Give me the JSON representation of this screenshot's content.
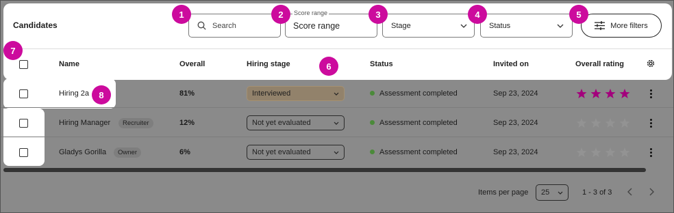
{
  "header": {
    "title": "Candidates"
  },
  "filters": {
    "search_placeholder": "Search",
    "score_range_label": "Score range",
    "score_range_value": "Score range",
    "stage": "Stage",
    "status": "Status",
    "more_filters": "More filters"
  },
  "columns": [
    "Name",
    "Overall",
    "Hiring stage",
    "Status",
    "Invited on",
    "Overall rating"
  ],
  "rows": [
    {
      "name": "Hiring 2a",
      "tag": "",
      "overall": "81%",
      "stage": "Interviewed",
      "status": "Assessment completed",
      "invited": "Sep 23, 2024",
      "rating": 4
    },
    {
      "name": "Hiring Manager",
      "tag": "Recruiter",
      "overall": "12%",
      "stage": "Not yet evaluated",
      "status": "Assessment completed",
      "invited": "Sep 23, 2024",
      "rating": 0
    },
    {
      "name": "Gladys Gorilla",
      "tag": "Owner",
      "overall": "6%",
      "stage": "Not yet evaluated",
      "status": "Assessment completed",
      "invited": "Sep 23, 2024",
      "rating": 0
    }
  ],
  "pagination": {
    "items_per_page_label": "Items per page",
    "items_per_page": "25",
    "range": "1 - 3 of 3"
  },
  "badges": [
    "1",
    "2",
    "3",
    "4",
    "5",
    "6",
    "7",
    "8"
  ],
  "colors": {
    "badge": "#cc0b9d",
    "star": "#a3007c",
    "status_dot": "#4b8a3a"
  }
}
